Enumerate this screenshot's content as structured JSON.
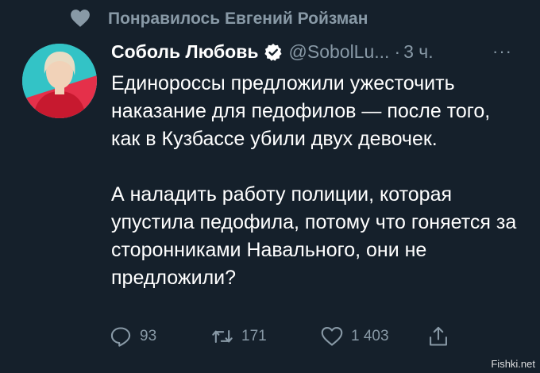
{
  "social_context": {
    "text": "Понравилось Евгений Ройзман",
    "icon": "heart-icon"
  },
  "tweet": {
    "author_name": "Соболь Любовь",
    "handle": "@SobolLu...",
    "separator": "·",
    "time": "3 ч.",
    "more_label": "···",
    "paragraphs": [
      "Единороссы предложили ужесточить наказание для педофилов — после того, как в Кузбассе убили двух девочек.",
      "А наладить работу полиции, которая упустила педофила, потому что гоняется за сторонниками Навального, они не предложили?"
    ],
    "actions": {
      "reply_count": "93",
      "retweet_count": "171",
      "like_count": "1 403"
    }
  },
  "watermark": "Fishki.net",
  "colors": {
    "background": "#15202b",
    "secondary_text": "#8899a6",
    "verified": "#ffffff"
  }
}
